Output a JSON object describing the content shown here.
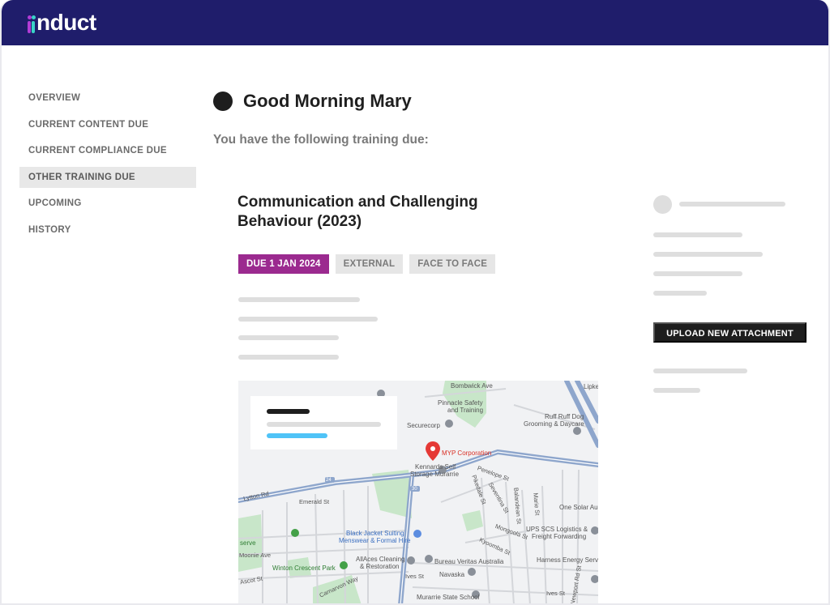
{
  "brand": {
    "logo_text": "nduct"
  },
  "sidebar": {
    "items": [
      {
        "label": "OVERVIEW",
        "active": false
      },
      {
        "label": "CURRENT CONTENT DUE",
        "active": false
      },
      {
        "label": "CURRENT COMPLIANCE DUE",
        "active": false
      },
      {
        "label": "OTHER TRAINING DUE",
        "active": true
      },
      {
        "label": "UPCOMING",
        "active": false
      },
      {
        "label": "HISTORY",
        "active": false
      }
    ]
  },
  "main": {
    "greeting": "Good Morning Mary",
    "subtitle": "You have the following training due:",
    "course": {
      "title": "Communication and Challenging Behaviour (2023)",
      "tags": {
        "due": "DUE 1 JAN 2024",
        "type": "EXTERNAL",
        "mode": "FACE TO FACE"
      }
    }
  },
  "side_panel": {
    "upload_label": "UPLOAD NEW ATTACHMENT"
  },
  "map": {
    "labels": {
      "bombwick": "Bombwick Ave",
      "pinnacle": "Pinnacle Safety",
      "pinnacle2": "and Training",
      "securecorp": "Securecorp",
      "ruff": "Ruff Ruff Dog",
      "ruff2": "Grooming & Daycare",
      "lipke": "Lipke",
      "myp": "MYP Corporation",
      "kennards": "Kennards Self",
      "kennards2": "Storage Murarrie",
      "penelope": "Penelope St",
      "lytton": "Lytton Rd",
      "emerald": "Emerald St",
      "blackjacket": "Black Jacket Suiting",
      "blackjacket2": "Menswear & Formal Hire",
      "onesolar": "One Solar Au",
      "ups": "UPS SCS Logistics &",
      "ups2": "Freight Forwarding",
      "serve": "serve",
      "moonie": "Moonie Ave",
      "winton": "Winton Crescent Park",
      "allaces": "AllAces Cleaning",
      "allaces2": "& Restoration",
      "bureau": "Bureau Veritas Australia",
      "harness": "Harness Energy Serv",
      "ascot": "Ascot St",
      "carnarvon": "Carnarvon Way",
      "ives": "Ives St",
      "ives2": "Ives St",
      "navaska": "Navaska",
      "murarrie": "Murarrie State School",
      "kyoomba": "Kyoomba St",
      "mongoola": "Mongoola St",
      "pikedale": "Pikedale St",
      "serenitas": "Seventina St",
      "balandean": "Balandean St",
      "marie": "Marie St",
      "newport": "Newport Rd St",
      "rd24": "24",
      "rd30": "30"
    }
  },
  "colors": {
    "topbar": "#1f1d6b",
    "accent_due": "#9b2a8f",
    "logo_purple": "#b23cd6",
    "logo_teal": "#39d3c7",
    "map_road": "#8ea6cc",
    "map_pin": "#e53935",
    "map_park": "#c8e6c9",
    "map_link": "#4fc3f7"
  }
}
